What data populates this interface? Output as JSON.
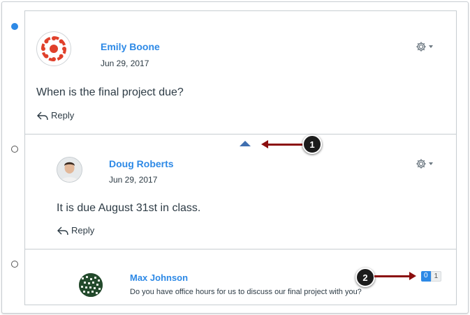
{
  "colors": {
    "link": "#2d89e6",
    "callout_arrow": "#8b0e0e",
    "unread_dot": "#2d89e6",
    "text": "#2d3b45"
  },
  "entries": [
    {
      "author": "Emily Boone",
      "date": "Jun 29, 2017",
      "message": "When is the final project due?",
      "reply_label": "Reply",
      "avatar": "canvas-logo-avatar",
      "status": "unread"
    },
    {
      "author": "Doug Roberts",
      "date": "Jun 29, 2017",
      "message": "It is due August 31st in class.",
      "reply_label": "Reply",
      "avatar": "photo-avatar",
      "status": "read"
    },
    {
      "author": "Max Johnson",
      "message": "Do you have office hours for us to discuss our final project with you?",
      "avatar": "pattern-avatar",
      "status": "read",
      "unread_count": "0",
      "total_count": "1"
    }
  ],
  "callouts": [
    "1",
    "2"
  ]
}
